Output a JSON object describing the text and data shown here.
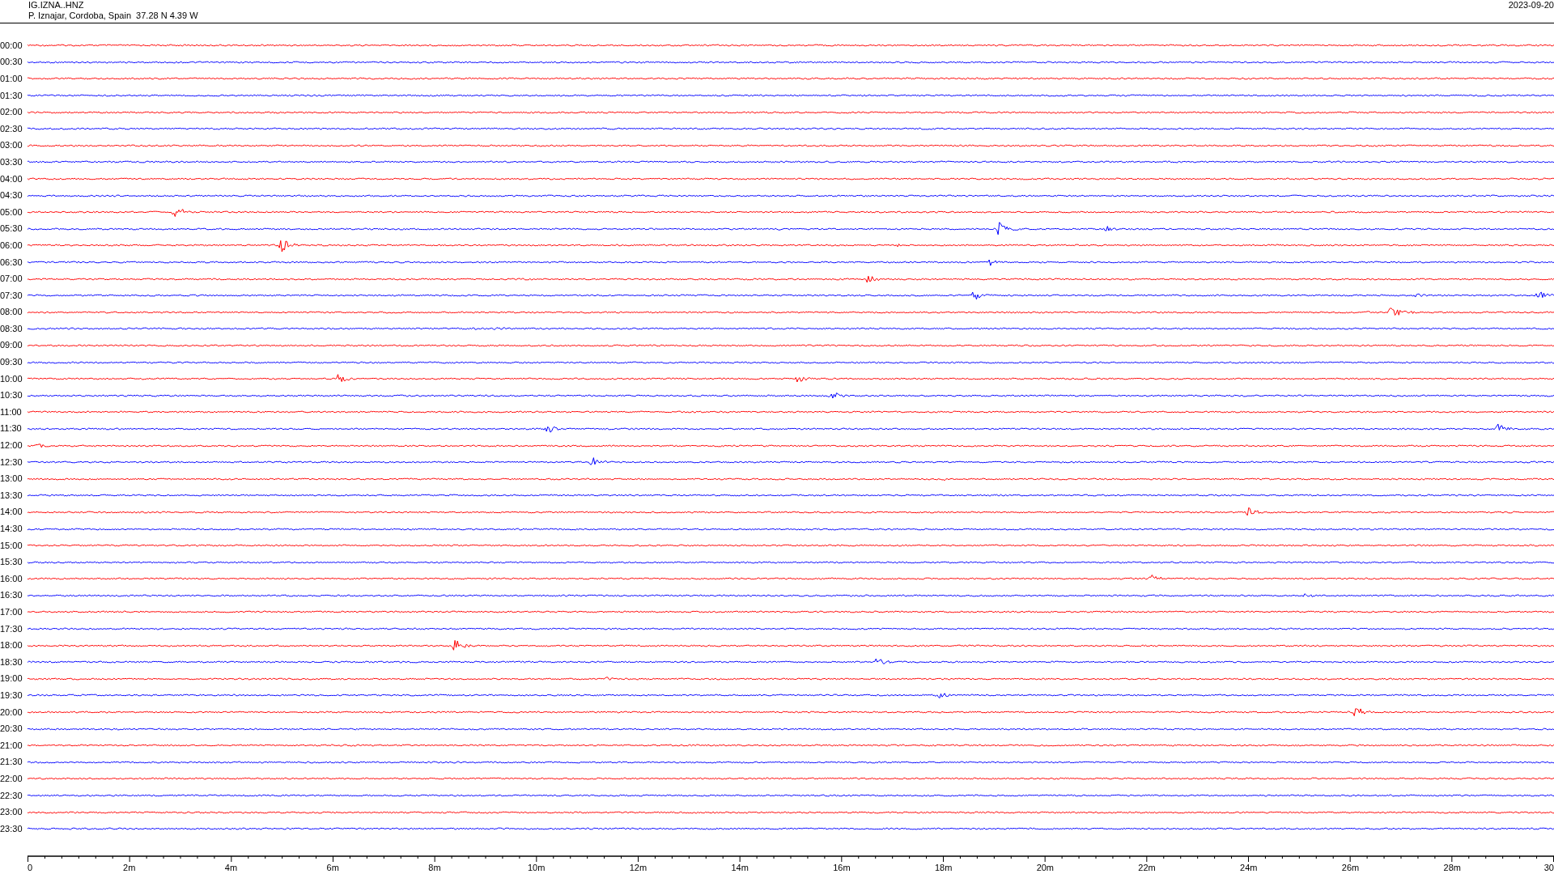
{
  "header": {
    "channel": "IG.IZNA..HNZ",
    "location": "P. Iznajar, Cordoba, Spain  37.28 N 4.39 W",
    "date": "2023-09-20"
  },
  "rows": [
    {
      "time": "00:00",
      "color": "#ff0000"
    },
    {
      "time": "00:30",
      "color": "#0000ff"
    },
    {
      "time": "01:00",
      "color": "#ff0000"
    },
    {
      "time": "01:30",
      "color": "#0000ff"
    },
    {
      "time": "02:00",
      "color": "#ff0000"
    },
    {
      "time": "02:30",
      "color": "#0000ff"
    },
    {
      "time": "03:00",
      "color": "#ff0000"
    },
    {
      "time": "03:30",
      "color": "#0000ff"
    },
    {
      "time": "04:00",
      "color": "#ff0000"
    },
    {
      "time": "04:30",
      "color": "#0000ff"
    },
    {
      "time": "05:00",
      "color": "#ff0000"
    },
    {
      "time": "05:30",
      "color": "#0000ff"
    },
    {
      "time": "06:00",
      "color": "#ff0000"
    },
    {
      "time": "06:30",
      "color": "#0000ff"
    },
    {
      "time": "07:00",
      "color": "#ff0000"
    },
    {
      "time": "07:30",
      "color": "#0000ff"
    },
    {
      "time": "08:00",
      "color": "#ff0000"
    },
    {
      "time": "08:30",
      "color": "#0000ff"
    },
    {
      "time": "09:00",
      "color": "#ff0000"
    },
    {
      "time": "09:30",
      "color": "#0000ff"
    },
    {
      "time": "10:00",
      "color": "#ff0000"
    },
    {
      "time": "10:30",
      "color": "#0000ff"
    },
    {
      "time": "11:00",
      "color": "#ff0000"
    },
    {
      "time": "11:30",
      "color": "#0000ff"
    },
    {
      "time": "12:00",
      "color": "#ff0000"
    },
    {
      "time": "12:30",
      "color": "#0000ff"
    },
    {
      "time": "13:00",
      "color": "#ff0000"
    },
    {
      "time": "13:30",
      "color": "#0000ff"
    },
    {
      "time": "14:00",
      "color": "#ff0000"
    },
    {
      "time": "14:30",
      "color": "#0000ff"
    },
    {
      "time": "15:00",
      "color": "#ff0000"
    },
    {
      "time": "15:30",
      "color": "#0000ff"
    },
    {
      "time": "16:00",
      "color": "#ff0000"
    },
    {
      "time": "16:30",
      "color": "#0000ff"
    },
    {
      "time": "17:00",
      "color": "#ff0000"
    },
    {
      "time": "17:30",
      "color": "#0000ff"
    },
    {
      "time": "18:00",
      "color": "#ff0000"
    },
    {
      "time": "18:30",
      "color": "#0000ff"
    },
    {
      "time": "19:00",
      "color": "#ff0000"
    },
    {
      "time": "19:30",
      "color": "#0000ff"
    },
    {
      "time": "20:00",
      "color": "#ff0000"
    },
    {
      "time": "20:30",
      "color": "#0000ff"
    },
    {
      "time": "21:00",
      "color": "#ff0000"
    },
    {
      "time": "21:30",
      "color": "#0000ff"
    },
    {
      "time": "22:00",
      "color": "#ff0000"
    },
    {
      "time": "22:30",
      "color": "#0000ff"
    },
    {
      "time": "23:00",
      "color": "#ff0000"
    },
    {
      "time": "23:30",
      "color": "#0000ff"
    }
  ],
  "axis_labels": [
    "0",
    "2m",
    "4m",
    "6m",
    "8m",
    "10m",
    "12m",
    "14m",
    "16m",
    "18m",
    "20m",
    "22m",
    "24m",
    "26m",
    "28m",
    "30"
  ]
}
